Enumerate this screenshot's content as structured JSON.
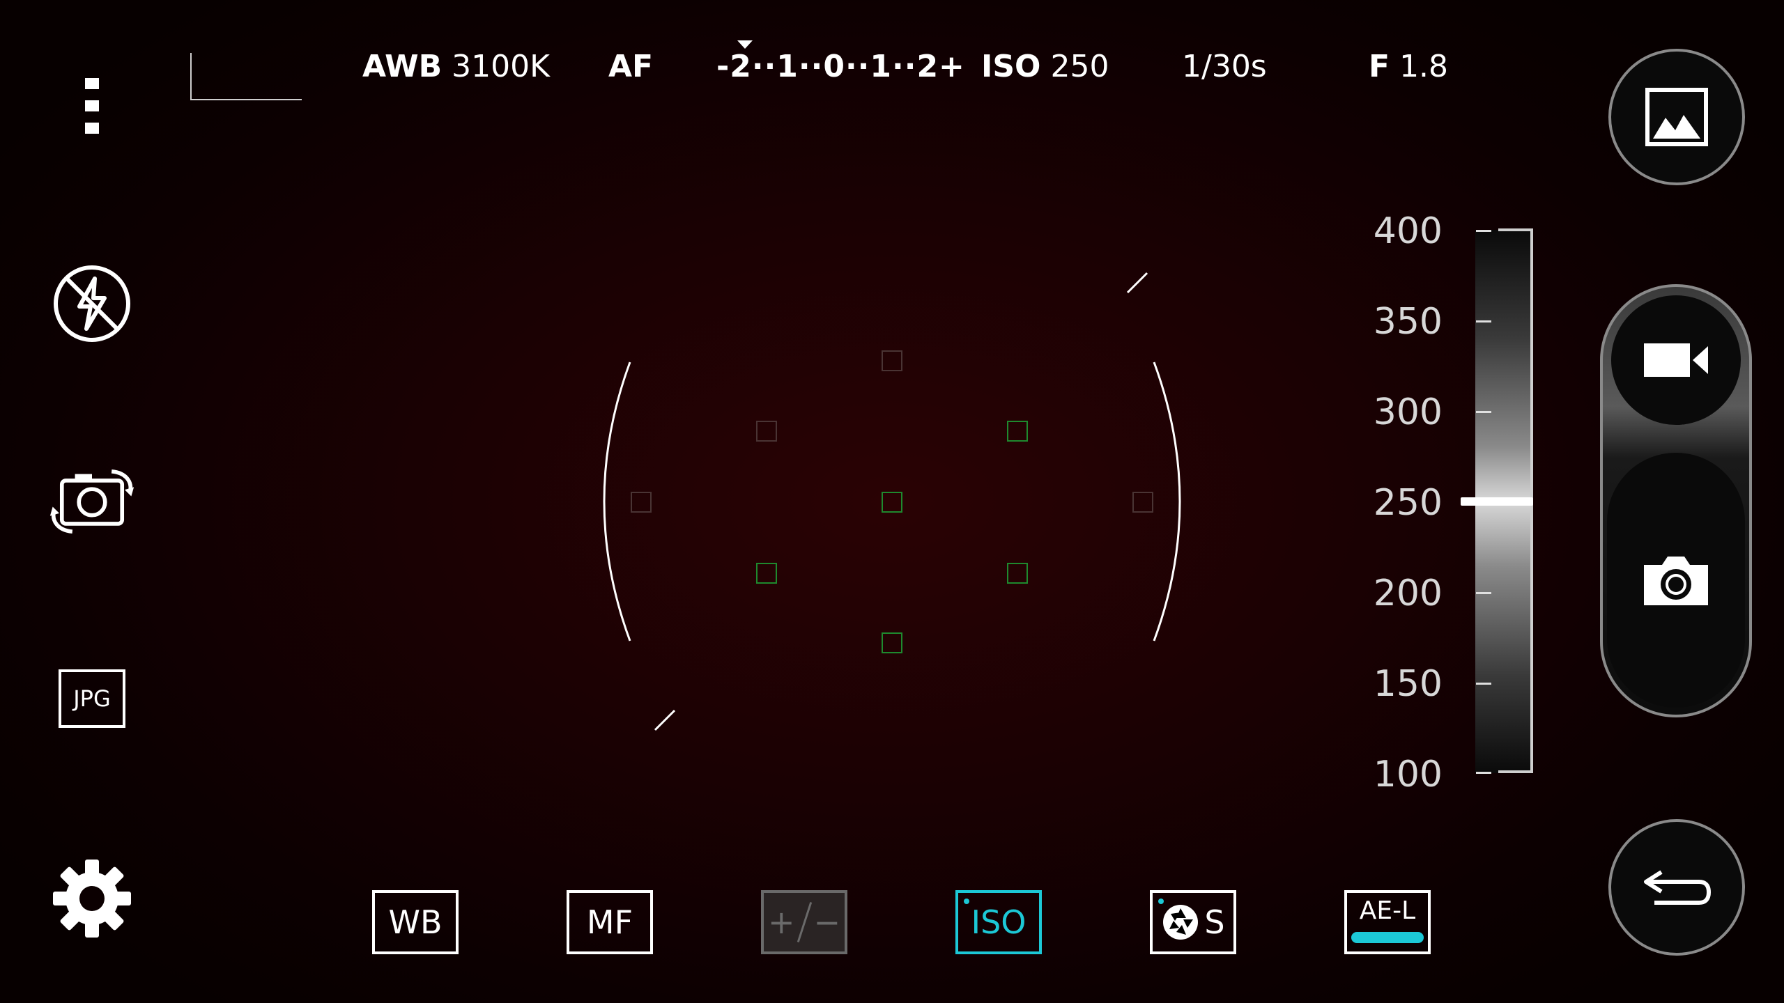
{
  "top_bar": {
    "awb_label": "AWB",
    "awb_value": "3100K",
    "af_label": "AF",
    "ev_scale": "-2··1··0··1··2+",
    "iso_label": "ISO",
    "iso_value": "250",
    "shutter": "1/30s",
    "aperture_label": "F",
    "aperture_value": "1.8"
  },
  "left_bar": {
    "menu_icon": "more-vert-icon",
    "flash_icon": "flash-off-icon",
    "switch_camera_icon": "switch-camera-icon",
    "format_label": "JPG",
    "settings_icon": "gear-icon"
  },
  "iso_scale": {
    "labels": [
      "400",
      "350",
      "300",
      "250",
      "200",
      "150",
      "100"
    ],
    "current_value": 250,
    "min": 100,
    "max": 400
  },
  "toolbar": {
    "wb": "WB",
    "mf": "MF",
    "ev_plus": "+",
    "ev_minus": "−",
    "iso": "ISO",
    "shutter_mode": "S",
    "ae_lock": "AE-L"
  },
  "colors": {
    "accent": "#1cc8d6",
    "af_point_active": "#1e8a2e",
    "af_point_inactive": "#4a3434"
  },
  "right_bar": {
    "gallery_icon": "gallery-icon",
    "video_icon": "video-camera-icon",
    "photo_icon": "camera-icon",
    "back_icon": "back-arrow-icon"
  }
}
